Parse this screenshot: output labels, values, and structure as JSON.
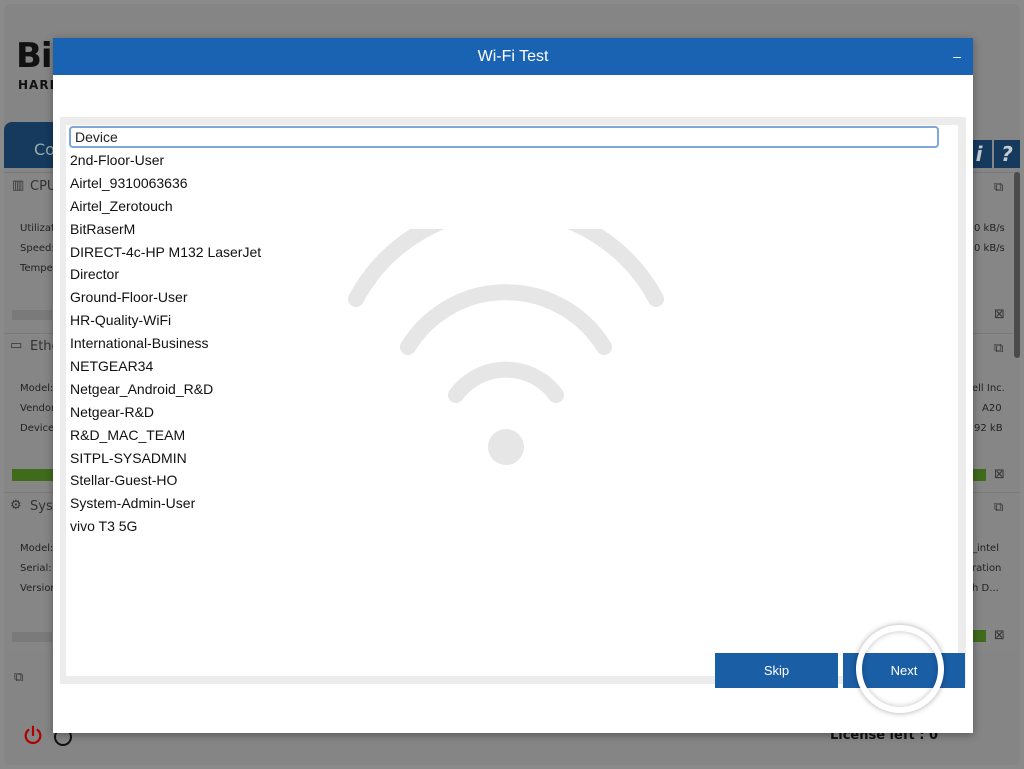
{
  "background": {
    "logo_text": "Bi",
    "logo_sub": "HARI",
    "tab_label": "Co",
    "info_button": "i",
    "help_button": "?",
    "panels": [
      {
        "title": "CPU",
        "labels": [
          "Utilizat",
          "Speed:",
          "Tempe"
        ],
        "values": [
          "0 kB/s",
          "0 kB/s"
        ]
      },
      {
        "title": "Ethe",
        "labels": [
          "Model:",
          "Vendor",
          "Device"
        ],
        "values": [
          "ell Inc.",
          "A20",
          "92 kB"
        ]
      },
      {
        "title": "Sys",
        "labels": [
          "Model:",
          "Serial:",
          "Version"
        ],
        "values": [
          "_intel",
          "ration",
          "h D..."
        ]
      }
    ],
    "license_text": "License left : 0"
  },
  "modal": {
    "title": "Wi-Fi Test",
    "minimize_label": "–",
    "column_header": "Device",
    "networks": [
      "2nd-Floor-User",
      "Airtel_9310063636",
      "Airtel_Zerotouch",
      "BitRaserM",
      "DIRECT-4c-HP M132 LaserJet",
      "Director",
      "Ground-Floor-User",
      "HR-Quality-WiFi",
      "International-Business",
      "NETGEAR34",
      "Netgear_Android_R&D",
      "Netgear-R&D",
      "R&D_MAC_TEAM",
      "SITPL-SYSADMIN",
      "Stellar-Guest-HO",
      "System-Admin-User",
      "vivo T3 5G"
    ],
    "skip_label": "Skip",
    "next_label": "Next"
  },
  "colors": {
    "header_blue": "#1a63b3",
    "button_blue": "#1a5ea6",
    "accent_green": "#3f6b1b",
    "power_red": "#aa0000"
  },
  "icons": {
    "watermark": "wifi-icon",
    "power": "power-icon"
  }
}
